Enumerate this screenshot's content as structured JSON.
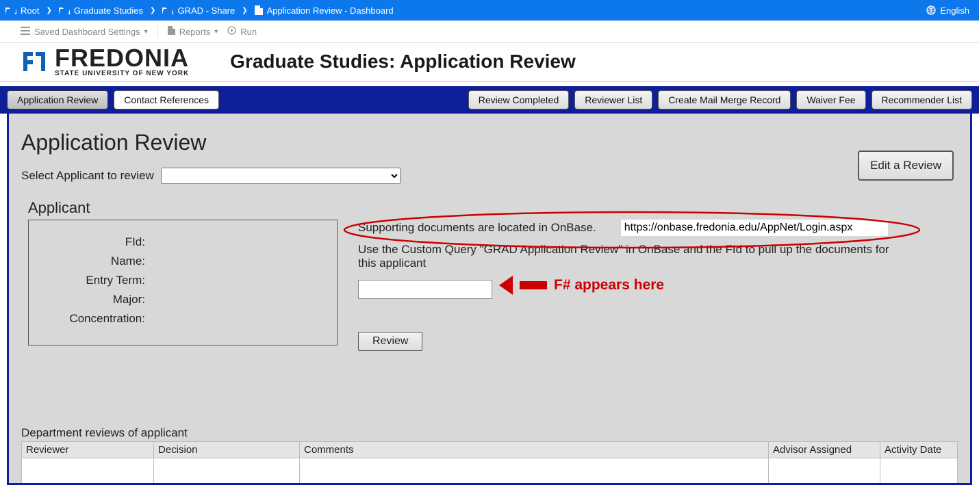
{
  "breadcrumbs": {
    "root": "Root",
    "grad_studies": "Graduate Studies",
    "grad_share": "GRAD - Share",
    "dashboard": "Application Review - Dashboard"
  },
  "language": "English",
  "toolbar": {
    "saved_settings": "Saved Dashboard Settings",
    "reports": "Reports",
    "run": "Run"
  },
  "logo": {
    "name": "FREDONIA",
    "sub": "STATE UNIVERSITY OF NEW YORK"
  },
  "page_title": "Graduate Studies: Application Review",
  "tabs": {
    "app_review": "Application Review",
    "contact_refs": "Contact References"
  },
  "actions": {
    "review_completed": "Review Completed",
    "reviewer_list": "Reviewer List",
    "create_mail_merge": "Create Mail Merge Record",
    "waiver_fee": "Waiver Fee",
    "recommender_list": "Recommender List"
  },
  "main": {
    "section_title": "Application Review",
    "edit_review": "Edit a Review",
    "select_label": "Select Applicant to review",
    "applicant_header": "Applicant",
    "fields": {
      "fid": "FId:",
      "name": "Name:",
      "entry_term": "Entry Term:",
      "major": "Major:",
      "concentration": "Concentration:"
    },
    "supporting_text": "Supporting documents are located in OnBase.",
    "onbase_url": "https://onbase.fredonia.edu/AppNet/Login.aspx",
    "instruction": "Use the Custom Query \"GRAD Application Review\" in OnBase and the FId to pull up the documents for this applicant",
    "review_btn": "Review",
    "annotation": "F# appears here"
  },
  "reviews": {
    "title": "Department reviews of applicant",
    "columns": {
      "reviewer": "Reviewer",
      "decision": "Decision",
      "comments": "Comments",
      "advisor": "Advisor Assigned",
      "activity_date": "Activity Date"
    }
  }
}
